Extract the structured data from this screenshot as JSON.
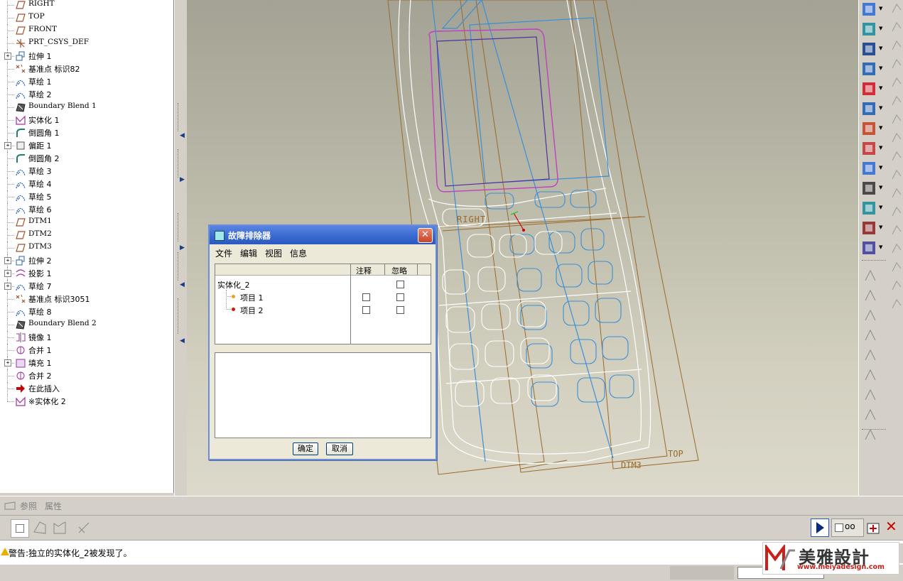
{
  "model_tree": {
    "items": [
      {
        "label": "RIGHT",
        "icon": "datum-plane-icon",
        "expandable": false
      },
      {
        "label": "TOP",
        "icon": "datum-plane-icon",
        "expandable": false
      },
      {
        "label": "FRONT",
        "icon": "datum-plane-icon",
        "expandable": false
      },
      {
        "label": "PRT_CSYS_DEF",
        "icon": "coordinate-system-icon",
        "expandable": false
      },
      {
        "label": "拉伸 1",
        "icon": "extrude-icon",
        "expandable": true
      },
      {
        "label": "基准点 标识82",
        "icon": "datum-point-icon",
        "expandable": false
      },
      {
        "label": "草绘 1",
        "icon": "sketch-icon",
        "expandable": false
      },
      {
        "label": "草绘 2",
        "icon": "sketch-icon",
        "expandable": false
      },
      {
        "label": "Boundary Blend 1",
        "icon": "boundary-blend-icon",
        "expandable": false
      },
      {
        "label": "实体化 1",
        "icon": "solidify-icon",
        "expandable": false
      },
      {
        "label": "倒圆角 1",
        "icon": "round-icon",
        "expandable": false
      },
      {
        "label": "偏距 1",
        "icon": "offset-icon",
        "expandable": true
      },
      {
        "label": "倒圆角 2",
        "icon": "round-icon",
        "expandable": false
      },
      {
        "label": "草绘 3",
        "icon": "sketch-icon",
        "expandable": false
      },
      {
        "label": "草绘 4",
        "icon": "sketch-icon",
        "expandable": false
      },
      {
        "label": "草绘 5",
        "icon": "sketch-icon",
        "expandable": false
      },
      {
        "label": "草绘 6",
        "icon": "sketch-icon",
        "expandable": false
      },
      {
        "label": "DTM1",
        "icon": "datum-plane-icon",
        "expandable": false
      },
      {
        "label": "DTM2",
        "icon": "datum-plane-icon",
        "expandable": false
      },
      {
        "label": "DTM3",
        "icon": "datum-plane-icon",
        "expandable": false
      },
      {
        "label": "拉伸 2",
        "icon": "extrude-icon",
        "expandable": true
      },
      {
        "label": "投影 1",
        "icon": "projection-icon",
        "expandable": true
      },
      {
        "label": "草绘 7",
        "icon": "sketch-icon",
        "expandable": true
      },
      {
        "label": "基准点 标识3051",
        "icon": "datum-point-icon",
        "expandable": false
      },
      {
        "label": "草绘 8",
        "icon": "sketch-icon",
        "expandable": false
      },
      {
        "label": "Boundary Blend 2",
        "icon": "boundary-blend-icon",
        "expandable": false
      },
      {
        "label": "镜像 1",
        "icon": "mirror-icon",
        "expandable": false
      },
      {
        "label": "合并 1",
        "icon": "merge-icon",
        "expandable": false
      },
      {
        "label": "填充 1",
        "icon": "fill-icon",
        "expandable": true
      },
      {
        "label": "合并 2",
        "icon": "merge-icon",
        "expandable": false
      },
      {
        "label": "在此插入",
        "icon": "insert-here-arrow-icon",
        "expandable": false
      },
      {
        "label": "※实体化 2",
        "icon": "solidify-icon",
        "expandable": false
      }
    ]
  },
  "viewport": {
    "datum_labels": {
      "right": "RIGHT",
      "top": "TOP",
      "dtm3": "DTM3"
    }
  },
  "dialog": {
    "title": "故障排除器",
    "menu": [
      "文件",
      "编辑",
      "视图",
      "信息"
    ],
    "columns": {
      "note": "注释",
      "ignore": "忽略"
    },
    "tree": {
      "root": "实体化_2",
      "items": [
        {
          "label": "项目 1",
          "bullet_color": "#f0a020"
        },
        {
          "label": "项目 2",
          "bullet_color": "#c02000"
        }
      ]
    },
    "ok_label": "确定",
    "cancel_label": "取消"
  },
  "ref_tabs": [
    "参照",
    "属性"
  ],
  "message": "警告:独立的实体化_2被发现了。",
  "logo": {
    "text": "美雅設計",
    "url": "www.meiyadesign.com"
  },
  "colors": {
    "accent_blue": "#2a58c0",
    "curve_white": "#ffffff",
    "curve_blue": "#3a8fd8",
    "datum_brown": "#9a6a2a",
    "highlight_magenta": "#c040c0",
    "error_red": "#cc0000"
  }
}
